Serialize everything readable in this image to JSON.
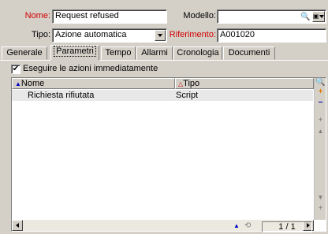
{
  "header": {
    "nome_label": "Nome:",
    "nome_value": "Request refused",
    "modello_label": "Modello:",
    "modello_value": "",
    "tipo_label": "Tipo:",
    "tipo_value": "Azione automatica",
    "riferimento_label": "Riferimento:",
    "riferimento_value": "A001020"
  },
  "tabs": [
    {
      "label": "Generale"
    },
    {
      "label": "Parametri"
    },
    {
      "label": "Tempo"
    },
    {
      "label": "Allarmi"
    },
    {
      "label": "Cronologia"
    },
    {
      "label": "Documenti"
    }
  ],
  "active_tab": "Parametri",
  "parametri": {
    "checkbox_label": "Eseguire le azioni immediatamente",
    "checkbox_checked": true,
    "columns": [
      "Nome",
      "Tipo"
    ],
    "rows": [
      {
        "nome": "Richiesta rifiutata",
        "tipo": "Script"
      }
    ],
    "pager": "1 / 1"
  },
  "colors": {
    "mandatory_label": "#d00000",
    "window_bg": "#d4d0c8"
  }
}
